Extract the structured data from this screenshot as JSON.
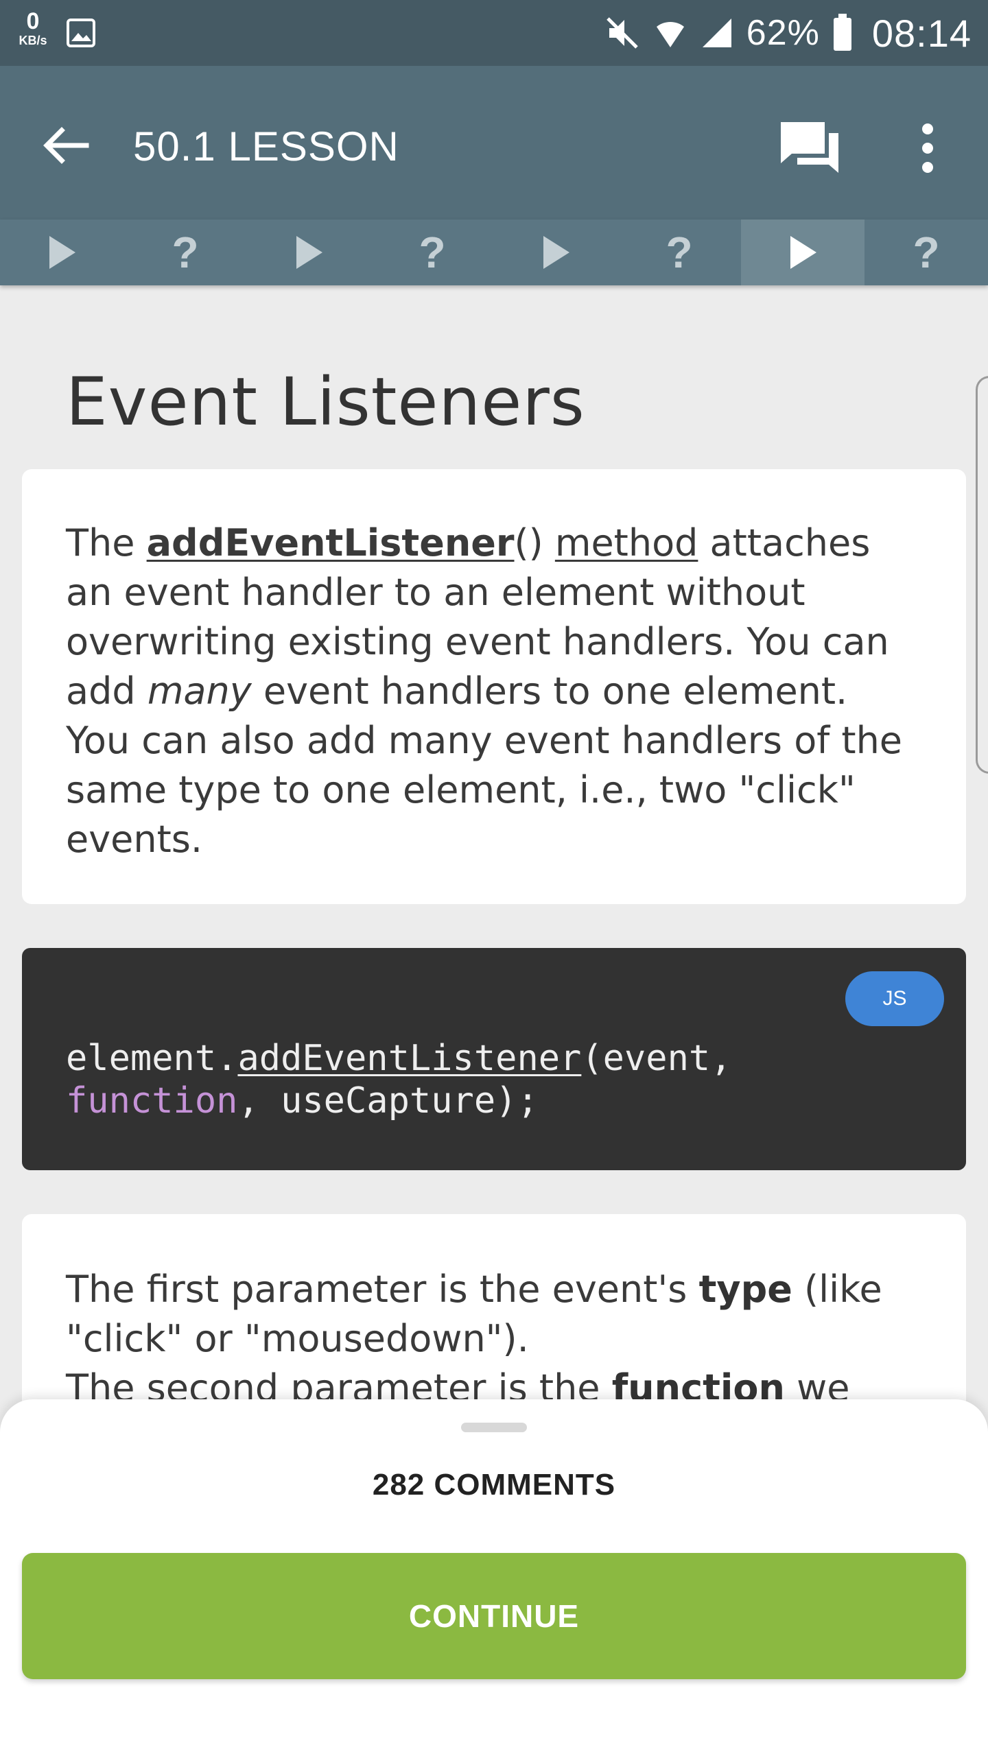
{
  "status_bar": {
    "net_speed": "0",
    "net_unit": "KB/s",
    "battery": "62%",
    "time": "08:14"
  },
  "app_bar": {
    "title": "50.1 LESSON"
  },
  "steps": [
    {
      "type": "play",
      "active": false
    },
    {
      "type": "quiz",
      "label": "?",
      "active": false
    },
    {
      "type": "play",
      "active": false
    },
    {
      "type": "quiz",
      "label": "?",
      "active": false
    },
    {
      "type": "play",
      "active": false
    },
    {
      "type": "quiz",
      "label": "?",
      "active": false
    },
    {
      "type": "play",
      "active": true
    },
    {
      "type": "quiz",
      "label": "?",
      "active": false
    }
  ],
  "lesson": {
    "title": "Event Listeners",
    "para1": {
      "t1": "The ",
      "method_name": "addEventListener",
      "t2": "() ",
      "method_word": "method",
      "t3": " attaches an event handler to an element without overwriting existing event handlers. You can add ",
      "many": "many",
      "t4": " event handlers to one element.",
      "t5": "You can also add many event handlers of the same type to one element, i.e., two \"click\" events."
    },
    "code": {
      "language": "JS",
      "line1_a": "element.",
      "line1_fn": "addEventListener",
      "line1_b": "(event,",
      "line2_kw": "function",
      "line2_b": ", useCapture);"
    },
    "para2": {
      "t1": "The first parameter is the event's ",
      "type_word": "type",
      "t2": " (like \"click\" or \"mousedown\").",
      "t3": "The second parameter is the ",
      "function_word": "function",
      "t4": " we want"
    }
  },
  "sheet": {
    "comments": "282 COMMENTS",
    "continue": "CONTINUE"
  },
  "colors": {
    "status_bar": "#455a64",
    "app_bar": "#546e7a",
    "continue": "#8bb941",
    "badge": "#3f84d6"
  }
}
